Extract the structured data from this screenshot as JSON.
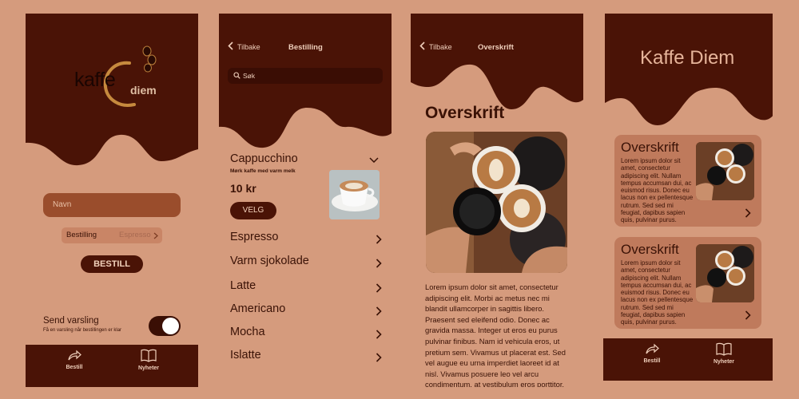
{
  "screen1": {
    "logo_word1": "kaffe",
    "logo_word2": "diem",
    "name_placeholder": "Navn",
    "order_label": "Bestilling",
    "order_value": "Espresso",
    "order_button": "BESTILL",
    "notify_title": "Send varsling",
    "notify_sub": "Få en varsling når bestillingen er klar",
    "tabs": [
      "Bestill",
      "Nyheter"
    ]
  },
  "screen2": {
    "back": "Tilbake",
    "title": "Bestilling",
    "search": "Søk",
    "selected": {
      "name": "Cappucchino",
      "desc": "Mørk kaffe med varm melk",
      "price": "10 kr",
      "button": "VELG"
    },
    "items": [
      "Espresso",
      "Varm sjokolade",
      "Latte",
      "Americano",
      "Mocha",
      "Islatte"
    ]
  },
  "screen3": {
    "back": "Tilbake",
    "title": "Overskrift",
    "heading": "Overskrift",
    "article": "Lorem ipsum dolor sit amet, consectetur adipiscing elit. Morbi ac metus nec mi blandit ullamcorper in sagittis libero. Praesent sed eleifend odio. Donec ac gravida massa. Integer ut eros eu purus pulvinar finibus. Nam id vehicula eros, ut pretium sem. Vivamus ut placerat est. Sed vel augue eu urna imperdiet laoreet id at nisl. Vivamus posuere leo vel arcu condimentum, at vestibulum eros porttitor."
  },
  "screen4": {
    "title": "Kaffe Diem",
    "cards": [
      {
        "title": "Overskrift",
        "body": "Lorem ipsum dolor sit amet, consectetur adipiscing elit. Nullam tempus accumsan dui, ac euismod risus. Donec eu lacus non ex pellentesque rutrum. Sed sed mi feugiat, dapibus sapien quis, pulvinar purus."
      },
      {
        "title": "Overskrift",
        "body": "Lorem ipsum dolor sit amet, consectetur adipiscing elit. Nullam tempus accumsan dui, ac euismod risus. Donec eu lacus non ex pellentesque rutrum. Sed sed mi feugiat, dapibus sapien quis, pulvinar purus."
      }
    ],
    "tabs": [
      "Bestill",
      "Nyheter"
    ]
  },
  "colors": {
    "dark_brown": "#4a1306",
    "background": "#d59b7d",
    "input": "#9a4d2c",
    "card": "#bf7a5c"
  },
  "icons": [
    "coffee-beans-icon",
    "back-chevron-icon",
    "search-icon",
    "chevron-down-icon",
    "chevron-right-icon",
    "share-arrow-icon",
    "open-book-icon"
  ]
}
